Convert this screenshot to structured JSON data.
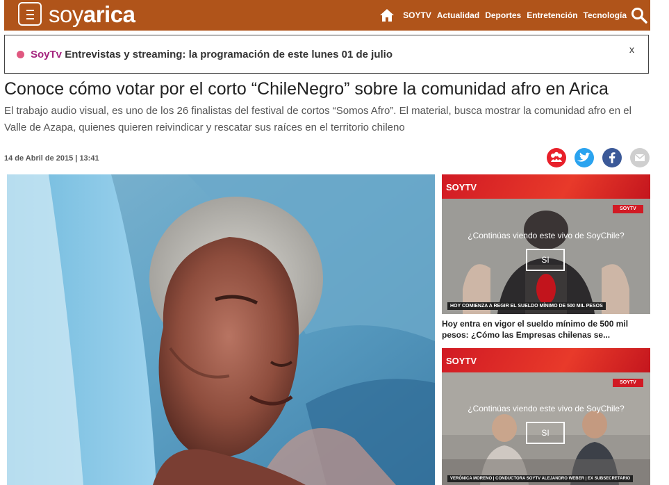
{
  "header": {
    "logo_prefix": "soy",
    "logo_suffix": "arica",
    "nav": [
      "SOYTV",
      "Actualidad",
      "Deportes",
      "Entretención",
      "Tecnología"
    ]
  },
  "notice": {
    "brand": "SoyTv",
    "text": "Entrevistas y streaming: la programación de este lunes 01 de julio",
    "close": "x"
  },
  "article": {
    "title": "Conoce cómo votar por el corto “ChileNegro” sobre la comunidad afro en Arica",
    "summary": "El trabajo audio visual, es uno de los 26 finalistas del festival de cortos “Somos Afro”. El material, busca mostrar la comunidad afro en el Valle de Azapa, quienes quieren reivindicar y rescatar sus raíces en el territorio chileno",
    "date": "14 de Abril de 2015 | 13:41"
  },
  "sidebar": [
    {
      "label": "SOYTV",
      "question": "¿Continúas viendo este vivo de SoyChile?",
      "button": "SI",
      "tag": "SOYTV",
      "lower": "HOY COMIENZA A REGIR EL SUELDO MÍNIMO DE 500 MIL PESOS",
      "caption": "Hoy entra en vigor el sueldo mínimo de 500 mil pesos: ¿Cómo las Empresas chilenas se..."
    },
    {
      "label": "SOYTV",
      "question": "¿Continúas viendo este vivo de SoyChile?",
      "button": "SI",
      "tag": "SOYTV",
      "lower": "VERÓNICA MORENO | CONDUCTORA SOYTV          ALEJANDRO WEBER | EX SUBSECRETARIO"
    }
  ],
  "colors": {
    "header_bg": "#b0541a",
    "soytv_red": "#d11a24",
    "notice_brand": "#a4247e"
  }
}
